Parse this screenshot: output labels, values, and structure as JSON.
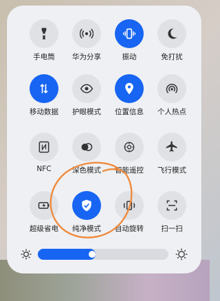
{
  "tiles": [
    {
      "label": "手电筒",
      "icon": "flashlight-icon",
      "active": false
    },
    {
      "label": "华为分享",
      "icon": "huawei-share-icon",
      "active": false
    },
    {
      "label": "振动",
      "icon": "vibrate-icon",
      "active": true
    },
    {
      "label": "免打扰",
      "icon": "do-not-disturb-icon",
      "active": false
    },
    {
      "label": "移动数据",
      "icon": "mobile-data-icon",
      "active": true
    },
    {
      "label": "护眼模式",
      "icon": "eye-comfort-icon",
      "active": false
    },
    {
      "label": "位置信息",
      "icon": "location-icon",
      "active": true
    },
    {
      "label": "个人热点",
      "icon": "hotspot-icon",
      "active": false
    },
    {
      "label": "NFC",
      "icon": "nfc-icon",
      "active": false
    },
    {
      "label": "深色模式",
      "icon": "dark-mode-icon",
      "active": false
    },
    {
      "label": "智能遥控",
      "icon": "remote-control-icon",
      "active": false
    },
    {
      "label": "飞行模式",
      "icon": "airplane-icon",
      "active": false
    },
    {
      "label": "超级省电",
      "icon": "battery-saver-icon",
      "active": false
    },
    {
      "label": "纯净模式",
      "icon": "pure-mode-shield-icon",
      "active": true
    },
    {
      "label": "自动旋转",
      "icon": "auto-rotate-icon",
      "active": false
    },
    {
      "label": "扫一扫",
      "icon": "scan-icon",
      "active": false
    }
  ],
  "brightness": {
    "level": 0.4
  },
  "colors": {
    "accent": "#1765f2",
    "tile_off": "#dfe1e5",
    "annotation": "#f08a3c"
  }
}
